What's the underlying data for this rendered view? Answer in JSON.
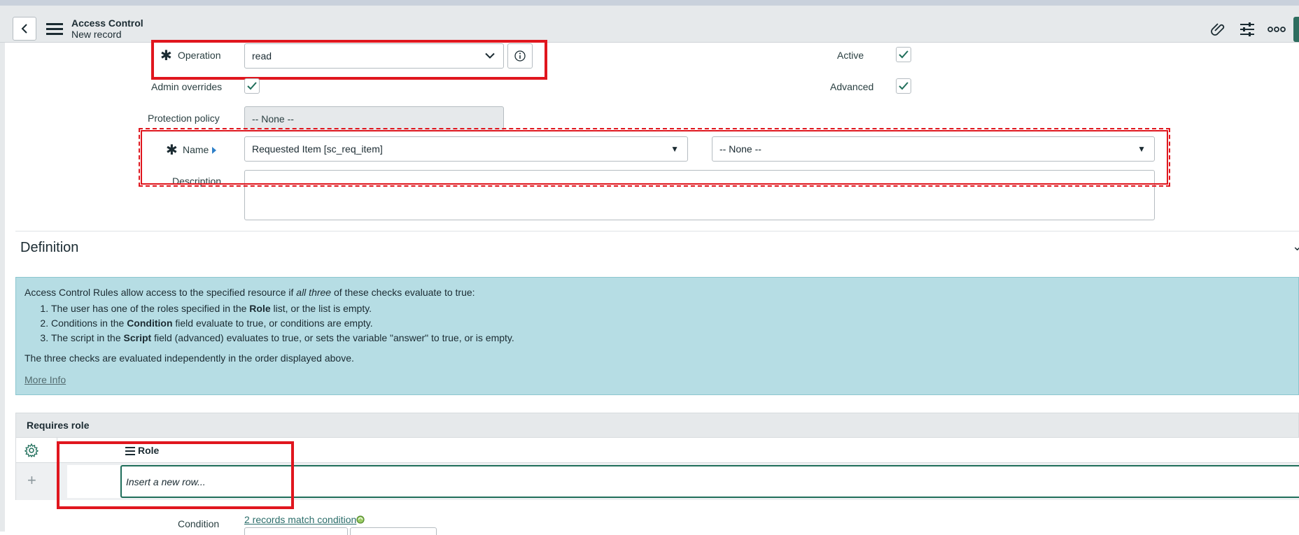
{
  "header": {
    "title": "Access Control",
    "subtitle": "New record",
    "icons": [
      "back-icon",
      "menu-icon",
      "paperclip-icon",
      "settings-sliders-icon",
      "more-options-icon"
    ]
  },
  "form": {
    "operation_label": "Operation",
    "operation_value": "read",
    "active_label": "Active",
    "active_checked": true,
    "admin_overrides_label": "Admin overrides",
    "admin_overrides_checked": true,
    "advanced_label": "Advanced",
    "advanced_checked": true,
    "protection_policy_label": "Protection policy",
    "protection_policy_value": "-- None --",
    "name_label": "Name",
    "name_table_value": "Requested Item [sc_req_item]",
    "name_field_value": "-- None --",
    "description_label": "Description",
    "description_value": ""
  },
  "definition": {
    "title": "Definition",
    "intro_before": "Access Control Rules allow access to the specified resource if ",
    "intro_em": "all three",
    "intro_after": " of these checks evaluate to true:",
    "items": [
      {
        "before": "The user has one of the roles specified in the ",
        "bold": "Role",
        "after": " list, or the list is empty."
      },
      {
        "before": "Conditions in the ",
        "bold": "Condition",
        "after": " field evaluate to true, or conditions are empty."
      },
      {
        "before": "The script in the ",
        "bold": "Script",
        "after": " field (advanced) evaluates to true, or sets the variable \"answer\" to true, or is empty."
      }
    ],
    "note": "The three checks are evaluated independently in the order displayed above.",
    "more_info": "More Info"
  },
  "requires_role": {
    "title": "Requires role",
    "column": "Role",
    "insert_placeholder": "Insert a new row..."
  },
  "condition": {
    "label": "Condition",
    "link": "2 records match condition"
  },
  "colors": {
    "accent": "#1f6e5a",
    "highlight": "#e0161e",
    "info_bg": "#b6dde4"
  }
}
